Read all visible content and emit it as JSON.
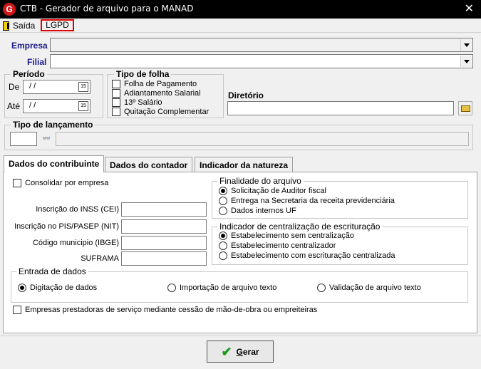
{
  "window": {
    "title": "CTB - Gerador de arquivo para o MANAD",
    "app_icon": "G"
  },
  "menu": {
    "exit_label": "Saída",
    "lgpd_label": "LGPD"
  },
  "empresa": {
    "label": "Empresa",
    "value": ""
  },
  "filial": {
    "label": "Filial",
    "value": ""
  },
  "periodo": {
    "title": "Período",
    "de_label": "De",
    "ate_label": "Até",
    "de_value": " /  /",
    "ate_value": " /  /",
    "calendar_glyph": "15"
  },
  "tipo_folha": {
    "title": "Tipo de folha",
    "options": [
      "Folha de Pagamento",
      "Adiantamento Salarial",
      "13º Salário",
      "Quitação Complementar"
    ]
  },
  "diretorio": {
    "label": "Diretório",
    "value": ""
  },
  "tipo_lancamento": {
    "title": "Tipo de lançamento",
    "code": "",
    "description": "",
    "lookup_glyph": "👓"
  },
  "tabs": [
    {
      "label": "Dados do contribuinte",
      "active": true
    },
    {
      "label": "Dados do contador",
      "active": false
    },
    {
      "label": "Indicador da natureza",
      "active": false
    }
  ],
  "contribuinte": {
    "consolidar_label": "Consolidar por empresa",
    "fields": [
      {
        "label": "Inscrição do INSS (CEI)",
        "value": ""
      },
      {
        "label": "Inscrição no PIS/PASEP (NIT)",
        "value": ""
      },
      {
        "label": "Código municipio (IBGE)",
        "value": ""
      },
      {
        "label": "SUFRAMA",
        "value": ""
      }
    ],
    "finalidade": {
      "title": "Finalidade do arquivo",
      "options": [
        "Solicitação de Auditor fiscal",
        "Entrega na Secretaria da receita previdenciária",
        "Dados internos UF"
      ],
      "selected": 0
    },
    "centralizacao": {
      "title": "Indicador de centralização de escrituração",
      "options": [
        "Estabelecimento sem centralização",
        "Estabelecimento centralizador",
        "Estabelecimento com escrituração centralizada"
      ],
      "selected": 0
    },
    "entrada": {
      "title": "Entrada de dados",
      "options": [
        "Digitação de dados",
        "Importação de arquivo texto",
        "Validação de arquivo texto"
      ],
      "selected": 0
    },
    "prestadoras_label": "Empresas prestadoras de serviço mediante cessão de mão-de-obra ou empreiteiras"
  },
  "gerar_label": "Gerar"
}
